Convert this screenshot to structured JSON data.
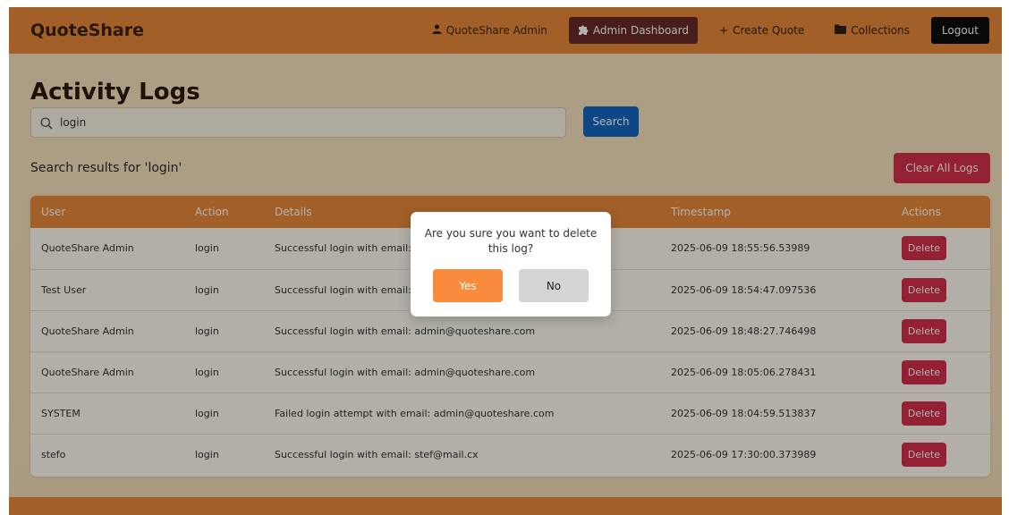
{
  "navbar": {
    "brand": "QuoteShare",
    "user_label": "QuoteShare Admin",
    "admin_dashboard_label": "Admin Dashboard",
    "create_quote_label": "Create Quote",
    "collections_label": "Collections",
    "logout_label": "Logout"
  },
  "page": {
    "title": "Activity Logs",
    "search": {
      "value": "login",
      "button_label": "Search"
    },
    "results_text": "Search results for 'login'",
    "clear_button_label": "Clear All Logs"
  },
  "table": {
    "headers": [
      "User",
      "Action",
      "Details",
      "Timestamp",
      "Actions"
    ],
    "rows": [
      {
        "user": "QuoteShare Admin",
        "action": "login",
        "details": "Successful login with email: admin@quoteshare.com",
        "timestamp": "2025-06-09 18:55:56.53989",
        "delete_label": "Delete"
      },
      {
        "user": "Test User",
        "action": "login",
        "details": "Successful login with email: test@quoteshare.com",
        "timestamp": "2025-06-09 18:54:47.097536",
        "delete_label": "Delete"
      },
      {
        "user": "QuoteShare Admin",
        "action": "login",
        "details": "Successful login with email: admin@quoteshare.com",
        "timestamp": "2025-06-09 18:48:27.746498",
        "delete_label": "Delete"
      },
      {
        "user": "QuoteShare Admin",
        "action": "login",
        "details": "Successful login with email: admin@quoteshare.com",
        "timestamp": "2025-06-09 18:05:06.278431",
        "delete_label": "Delete"
      },
      {
        "user": "SYSTEM",
        "action": "login",
        "details": "Failed login attempt with email: admin@quoteshare.com",
        "timestamp": "2025-06-09 18:04:59.513837",
        "delete_label": "Delete"
      },
      {
        "user": "stefo",
        "action": "login",
        "details": "Successful login with email: stef@mail.cx",
        "timestamp": "2025-06-09 17:30:00.373989",
        "delete_label": "Delete"
      }
    ]
  },
  "modal": {
    "message": "Are you sure you want to delete this log?",
    "yes_label": "Yes",
    "no_label": "No"
  },
  "colors": {
    "navbar": "#e8893a",
    "admin_dashboard_bg": "#6b2a2a",
    "search_button": "#1565c0",
    "danger": "#d32f4a",
    "yes_button": "#f88b3c"
  },
  "icons": {
    "user": "user-icon",
    "admin": "puzzle-icon",
    "create": "plus-icon",
    "collections": "folder-icon",
    "search": "search-icon"
  }
}
